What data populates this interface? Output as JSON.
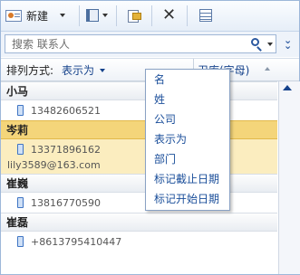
{
  "toolbar": {
    "new_label": "新建"
  },
  "search": {
    "placeholder": "搜索 联系人"
  },
  "arrange": {
    "label": "排列方式:",
    "value": "表示为",
    "column": "卫库(字母)"
  },
  "groups": [
    {
      "name": "小马",
      "items": [
        {
          "phone": "13482606521"
        }
      ]
    },
    {
      "name": "岑莉",
      "items": [
        {
          "phone": "13371896162",
          "email": "lily3589@163.com"
        }
      ],
      "selected": true
    },
    {
      "name": "崔巍",
      "items": [
        {
          "phone": "13816770590"
        }
      ]
    },
    {
      "name": "崔磊",
      "items": [
        {
          "phone": "+8613795410447"
        }
      ]
    }
  ],
  "menu": {
    "items": [
      "名",
      "姓",
      "公司",
      "表示为",
      "部门",
      "标记截止日期",
      "标记开始日期"
    ]
  },
  "colors": {
    "accent": "#15428b",
    "selection": "#fbedbf",
    "selection_header": "#f4d57a",
    "border": "#9db7d9"
  }
}
